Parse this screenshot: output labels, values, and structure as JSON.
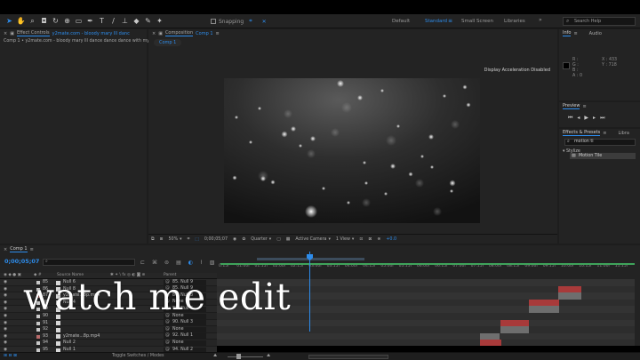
{
  "toolbar": {
    "snapping_label": "Snapping",
    "workspaces": [
      {
        "label": "Default",
        "active": false
      },
      {
        "label": "Standard",
        "active": true
      },
      {
        "label": "Small Screen",
        "active": false
      },
      {
        "label": "Libraries",
        "active": false
      }
    ],
    "search_placeholder": "Search Help"
  },
  "effect_controls": {
    "tab_label": "Effect Controls",
    "tab_target": "y2mate.com - bloody mary lll danc",
    "subtitle": "Comp 1 • y2mate.com - bloody mary lll dance dance dance with my h"
  },
  "composition": {
    "tab_prefix": "Composition",
    "tab_name": "Comp 1",
    "pill_label": "Comp 1",
    "notice": "Display Acceleration Disabled",
    "zoom": "50%",
    "timecode": "0;00;05;07",
    "resolution": "Quarter",
    "camera": "Active Camera",
    "view": "1 View",
    "offset": "+0.0"
  },
  "info": {
    "tab_info": "Info",
    "tab_audio": "Audio",
    "r_label": "R :",
    "g_label": "G :",
    "b_label": "B :",
    "a_label": "A : 0",
    "x_label": "X : 433",
    "y_label": "Y : 718"
  },
  "preview": {
    "tab_label": "Preview"
  },
  "effects_presets": {
    "tab_label": "Effects & Presets",
    "tab_libra": "Libra",
    "search_value": "motion ti",
    "category": "Stylize",
    "item": "Motion Tile"
  },
  "timeline": {
    "tab_label": "Comp 1",
    "current_time": "0;00;05;07",
    "ruler_labels": [
      "0:15f",
      "01:00f",
      "01:15f",
      "02:00f",
      "02:15f",
      "03:00f",
      "03:15f",
      "04:00f",
      "04:15f",
      "05:00f",
      "05:15f",
      "06:00f",
      "06:15f",
      "07:00f",
      "07:15f",
      "08:00f",
      "08:15f",
      "09:00f",
      "09:15f",
      "10:00f",
      "10:15f",
      "11:00f",
      "11:15f"
    ],
    "column_source": "Source Name",
    "column_parent": "Parent",
    "layers": [
      {
        "num": "85",
        "name": "Null 6",
        "color": "#c8c8c8",
        "parent": "85. Null 9"
      },
      {
        "num": "86",
        "name": "Null 8",
        "color": "#c8c8c8",
        "parent": "85. Null 9"
      },
      {
        "num": "87",
        "name": "y2mate...8p.mp4",
        "color": "#b86a6a",
        "parent": "86. Null 8"
      },
      {
        "num": "88",
        "name": "Null 4",
        "color": "#c8c8c8",
        "parent": "None"
      },
      {
        "num": "89",
        "name": "",
        "color": "#c8c8c8",
        "parent": "88. Null 4"
      },
      {
        "num": "90",
        "name": "",
        "color": "#c8c8c8",
        "parent": "None"
      },
      {
        "num": "91",
        "name": "",
        "color": "#c8c8c8",
        "parent": "90. Null 3"
      },
      {
        "num": "92",
        "name": "",
        "color": "#c8c8c8",
        "parent": "None"
      },
      {
        "num": "93",
        "name": "y2mate...8p.mp4",
        "color": "#b86a6a",
        "parent": "92. Null 1"
      },
      {
        "num": "94",
        "name": "Null 2",
        "color": "#c8c8c8",
        "parent": "None"
      },
      {
        "num": "95",
        "name": "Null 1",
        "color": "#c8c8c8",
        "parent": "94. Null 2"
      }
    ],
    "footer_label": "Toggle Switches / Modes"
  },
  "caption": "watch me edit",
  "colors": {
    "accent": "#2d8ceb",
    "clip_red": "#a83a3a",
    "clip_gray": "#6e6e6e",
    "keyframe_green": "#3fa35a"
  }
}
